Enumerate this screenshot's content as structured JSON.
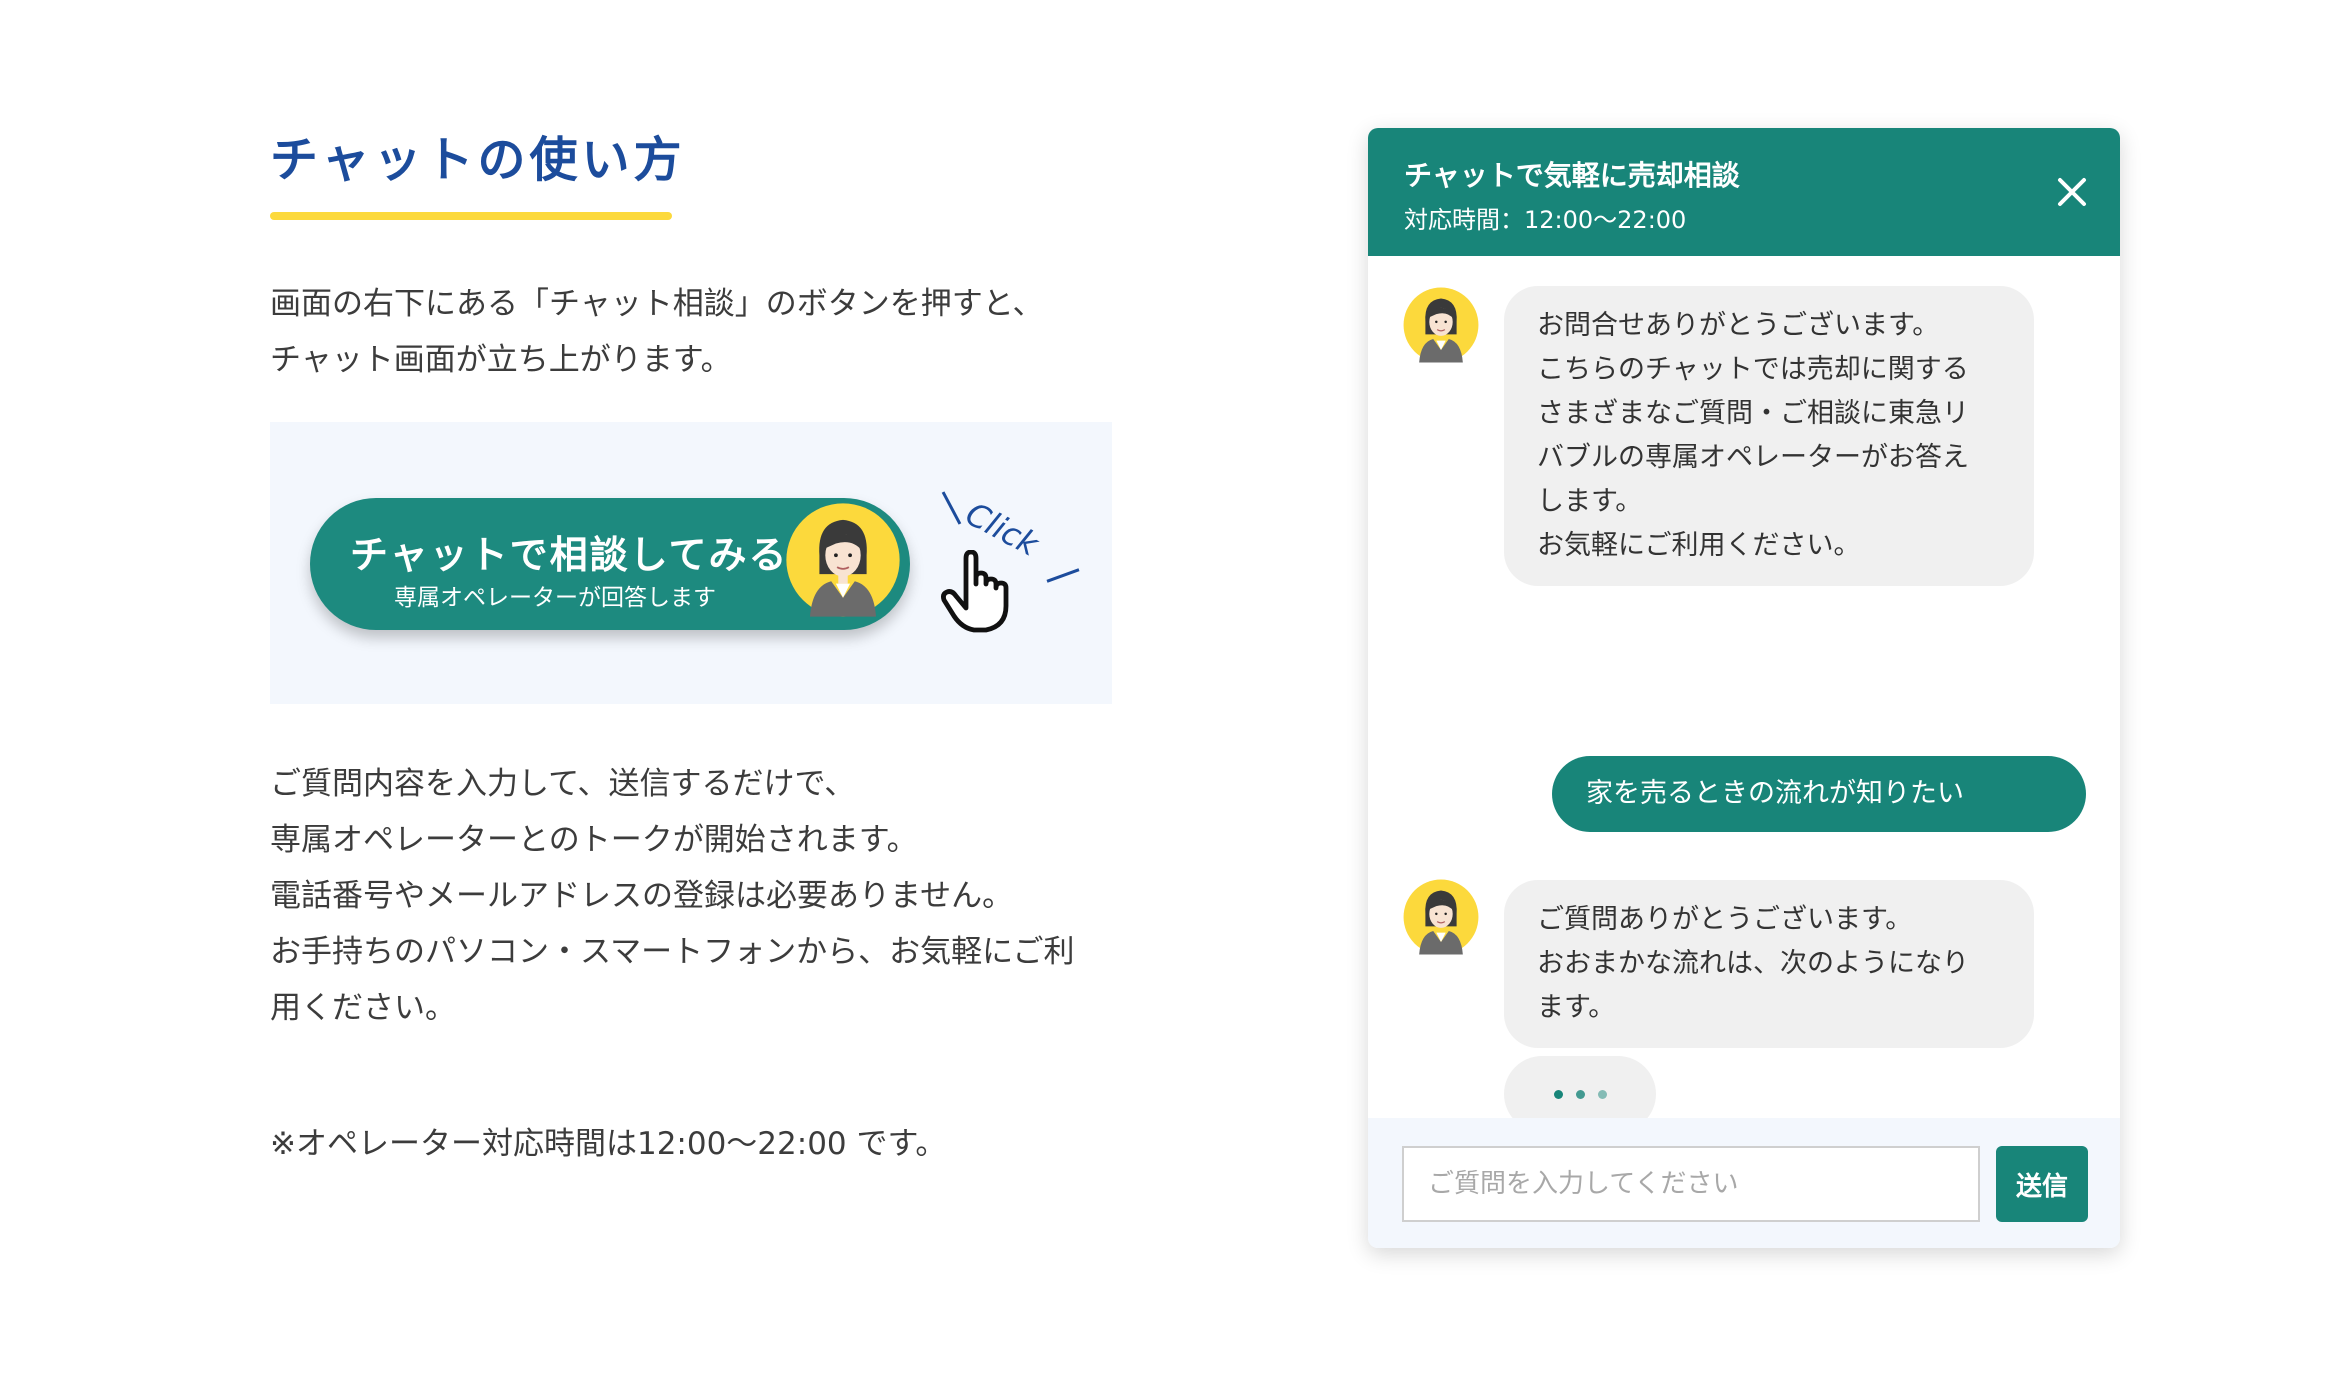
{
  "howto": {
    "heading": "チャットの使い方",
    "intro_lines": [
      "画面の右下にある「チャット相談」のボタンを押すと、",
      "チャット画面が立ち上がります。"
    ],
    "cta": {
      "main_label": "チャットで相談してみる",
      "sub_label": "専属オペレーターが回答します",
      "click_word": "Click"
    },
    "body_lines": [
      "ご質問内容を入力して、送信するだけで、",
      "専属オペレーターとのトークが開始されます。",
      "電話番号やメールアドレスの登録は必要ありません。",
      "お手持ちのパソコン・スマートフォンから、お気軽にご利",
      "用ください。"
    ],
    "note": "※オペレーター対応時間は12:00〜22:00 です。"
  },
  "chat": {
    "title": "チャットで気軽に売却相談",
    "hours": "対応時間：12:00〜22:00",
    "messages": {
      "op1_lines": [
        "お問合せありがとうございます。",
        "こちらのチャットでは売却に関する",
        "さまざまなご質問・ご相談に東急リ",
        "バブルの専属オペレーターがお答え",
        "します。",
        "お気軽にご利用ください。"
      ],
      "user1": "家を売るときの流れが知りたい",
      "op2_lines": [
        "ご質問ありがとうございます。",
        "おおまかな流れは、次のようになり",
        "ます。"
      ]
    },
    "input_placeholder": "ご質問を入力してください",
    "send_label": "送信"
  },
  "colors": {
    "brand_teal": "#188579",
    "heading_blue": "#1c4c9c",
    "accent_yellow": "#fcd93c"
  },
  "icons": [
    "close-icon",
    "operator-avatar-icon",
    "pointing-hand-icon"
  ]
}
